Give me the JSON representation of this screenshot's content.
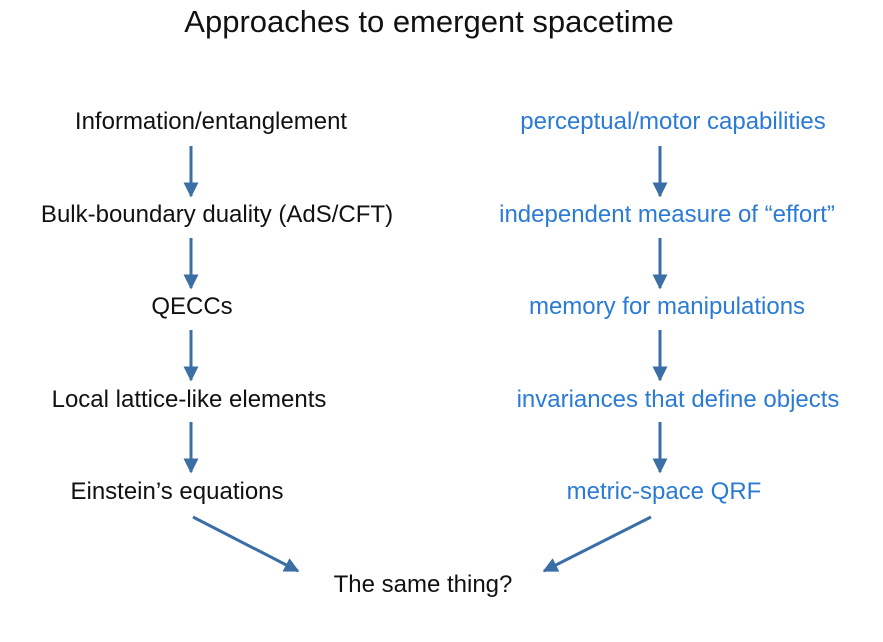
{
  "title": "Approaches to emergent spacetime",
  "left_chain": [
    "Information/entanglement",
    "Bulk-boundary duality (AdS/CFT)",
    "QECCs",
    "Local lattice-like elements",
    "Einstein’s equations"
  ],
  "right_chain": [
    "perceptual/motor capabilities",
    "independent measure of “effort”",
    "memory for manipulations",
    "invariances that define objects",
    "metric-space QRF"
  ],
  "conclusion": "The same thing?",
  "colors": {
    "left_text": "#111111",
    "right_text": "#2b7bd6",
    "arrow": "#3a6ea5"
  }
}
